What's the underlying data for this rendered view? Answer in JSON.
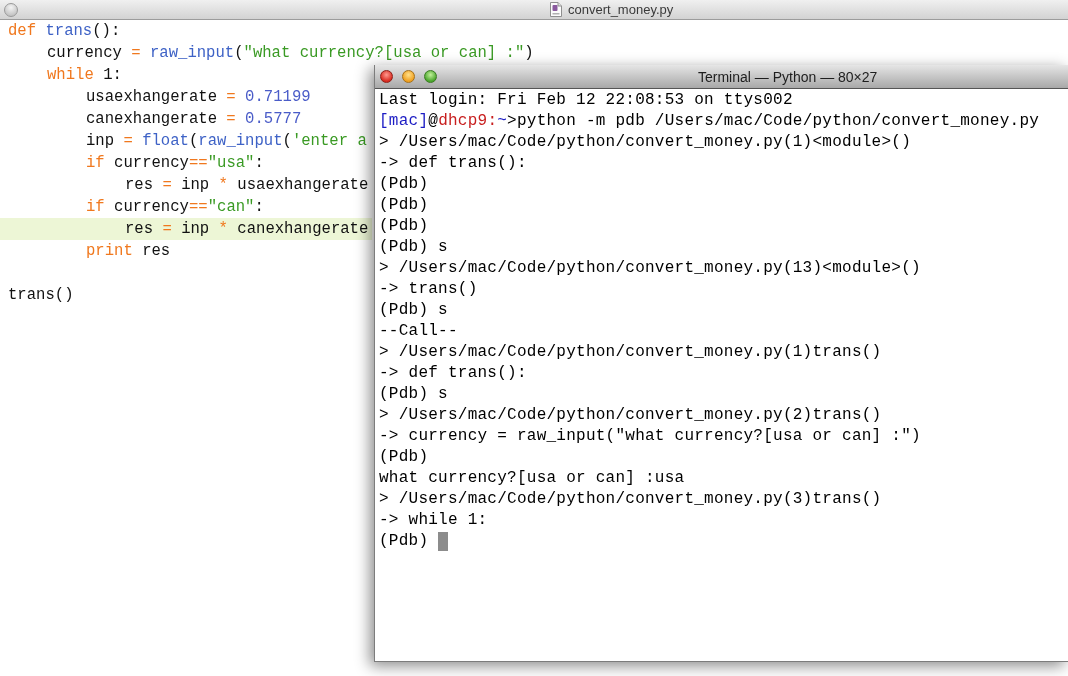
{
  "editor": {
    "title": "convert_money.py",
    "lines": [
      {
        "highlighted": false,
        "tokens": [
          {
            "kind": "keyword",
            "text": "def "
          },
          {
            "kind": "function",
            "text": "trans"
          },
          {
            "kind": "plain",
            "text": "():"
          }
        ],
        "children": [
          {
            "highlighted": false,
            "tokens": [
              {
                "kind": "plain",
                "text": "currency"
              },
              {
                "kind": "operator",
                "text": " = "
              },
              {
                "kind": "function",
                "text": "raw_input"
              },
              {
                "kind": "plain",
                "text": "("
              },
              {
                "kind": "string",
                "text": "\"what currency?[usa or can] :\""
              },
              {
                "kind": "plain",
                "text": ")"
              }
            ]
          },
          {
            "highlighted": false,
            "tokens": [
              {
                "kind": "keyword",
                "text": "while"
              },
              {
                "kind": "plain",
                "text": " 1:"
              }
            ],
            "children": [
              {
                "highlighted": false,
                "tokens": [
                  {
                    "kind": "plain",
                    "text": "usaexhangerate"
                  },
                  {
                    "kind": "operator",
                    "text": " = "
                  },
                  {
                    "kind": "number",
                    "text": "0.71199"
                  }
                ]
              },
              {
                "highlighted": false,
                "tokens": [
                  {
                    "kind": "plain",
                    "text": "canexhangerate"
                  },
                  {
                    "kind": "operator",
                    "text": " = "
                  },
                  {
                    "kind": "number",
                    "text": "0.5777"
                  }
                ]
              },
              {
                "highlighted": false,
                "tokens": [
                  {
                    "kind": "plain",
                    "text": "inp"
                  },
                  {
                    "kind": "operator",
                    "text": " = "
                  },
                  {
                    "kind": "function",
                    "text": "float"
                  },
                  {
                    "kind": "plain",
                    "text": "("
                  },
                  {
                    "kind": "function",
                    "text": "raw_input"
                  },
                  {
                    "kind": "plain",
                    "text": "("
                  },
                  {
                    "kind": "string",
                    "text": "'enter a"
                  }
                ]
              },
              {
                "highlighted": false,
                "tokens": [
                  {
                    "kind": "keyword",
                    "text": "if"
                  },
                  {
                    "kind": "plain",
                    "text": " currency"
                  },
                  {
                    "kind": "operator",
                    "text": "=="
                  },
                  {
                    "kind": "string",
                    "text": "\"usa\""
                  },
                  {
                    "kind": "plain",
                    "text": ":"
                  }
                ],
                "children": [
                  {
                    "highlighted": false,
                    "tokens": [
                      {
                        "kind": "plain",
                        "text": "res"
                      },
                      {
                        "kind": "operator",
                        "text": " = "
                      },
                      {
                        "kind": "plain",
                        "text": "inp"
                      },
                      {
                        "kind": "operator",
                        "text": " * "
                      },
                      {
                        "kind": "plain",
                        "text": "usaexhangerate"
                      }
                    ]
                  }
                ]
              },
              {
                "highlighted": false,
                "tokens": [
                  {
                    "kind": "keyword",
                    "text": "if"
                  },
                  {
                    "kind": "plain",
                    "text": " currency"
                  },
                  {
                    "kind": "operator",
                    "text": "=="
                  },
                  {
                    "kind": "string",
                    "text": "\"can\""
                  },
                  {
                    "kind": "plain",
                    "text": ":"
                  }
                ],
                "children": [
                  {
                    "highlighted": true,
                    "tokens": [
                      {
                        "kind": "plain",
                        "text": "res"
                      },
                      {
                        "kind": "operator",
                        "text": " = "
                      },
                      {
                        "kind": "plain",
                        "text": "inp"
                      },
                      {
                        "kind": "operator",
                        "text": " * "
                      },
                      {
                        "kind": "plain",
                        "text": "canexhangerate"
                      }
                    ]
                  }
                ]
              },
              {
                "highlighted": false,
                "tokens": [
                  {
                    "kind": "keyword",
                    "text": "print"
                  },
                  {
                    "kind": "plain",
                    "text": " res"
                  }
                ]
              }
            ]
          }
        ]
      },
      {
        "highlighted": false,
        "tokens": [
          {
            "kind": "plain",
            "text": "trans()"
          }
        ]
      }
    ]
  },
  "terminal": {
    "title": "Terminal — Python — 80×27",
    "lines": [
      {
        "kind": "output",
        "text": "Last login: Fri Feb 12 22:08:53 on ttys002"
      },
      {
        "kind": "prompt",
        "user": "[mac]",
        "separator": "@",
        "host": "dhcp9:",
        "path": "~",
        "command": ">python -m pdb /Users/mac/Code/python/convert_money.py"
      },
      {
        "kind": "output",
        "text": "> /Users/mac/Code/python/convert_money.py(1)<module>()"
      },
      {
        "kind": "output",
        "text": "-> def trans():"
      },
      {
        "kind": "output",
        "text": "(Pdb)"
      },
      {
        "kind": "output",
        "text": "(Pdb)"
      },
      {
        "kind": "output",
        "text": "(Pdb)"
      },
      {
        "kind": "output",
        "text": "(Pdb) s"
      },
      {
        "kind": "output",
        "text": "> /Users/mac/Code/python/convert_money.py(13)<module>()"
      },
      {
        "kind": "output",
        "text": "-> trans()"
      },
      {
        "kind": "output",
        "text": "(Pdb) s"
      },
      {
        "kind": "output",
        "text": "--Call--"
      },
      {
        "kind": "output",
        "text": "> /Users/mac/Code/python/convert_money.py(1)trans()"
      },
      {
        "kind": "output",
        "text": "-> def trans():"
      },
      {
        "kind": "output",
        "text": "(Pdb) s"
      },
      {
        "kind": "output",
        "text": "> /Users/mac/Code/python/convert_money.py(2)trans()"
      },
      {
        "kind": "output",
        "text": "-> currency = raw_input(\"what currency?[usa or can] :\")"
      },
      {
        "kind": "output",
        "text": "(Pdb)"
      },
      {
        "kind": "output",
        "text": "what currency?[usa or can] :usa"
      },
      {
        "kind": "output",
        "text": "> /Users/mac/Code/python/convert_money.py(3)trans()"
      },
      {
        "kind": "output",
        "text": "-> while 1:"
      },
      {
        "kind": "output",
        "text": "(Pdb)"
      }
    ]
  }
}
